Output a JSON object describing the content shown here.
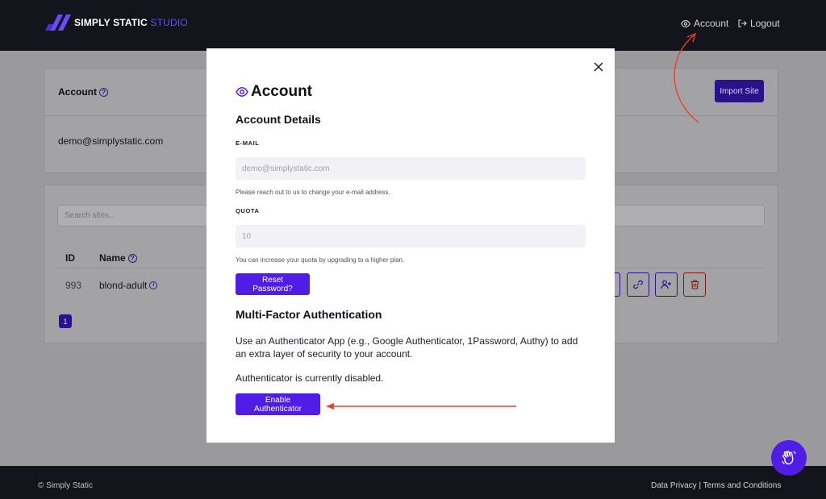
{
  "header": {
    "logo_main": "SIMPLY STATIC",
    "logo_accent": "STUDIO",
    "nav": {
      "account_label": "Account",
      "logout_label": "Logout"
    }
  },
  "background": {
    "account_card": {
      "title": "Account",
      "email": "demo@simplystatic.com",
      "import_label": "Import Site"
    },
    "sites_card": {
      "search_placeholder": "Search sites..",
      "columns": {
        "id": "ID",
        "name": "Name"
      },
      "rows": [
        {
          "id": "993",
          "name": "blond-adult"
        }
      ],
      "current_page": "1"
    }
  },
  "modal": {
    "title": "Account",
    "details_heading": "Account Details",
    "email_label": "E-MAIL",
    "email_placeholder": "demo@simplystatic.com",
    "email_hint": "Please reach out to us to change your e-mail address.",
    "quota_label": "QUOTA",
    "quota_placeholder": "10",
    "quota_hint": "You can increase your quota by upgrading to a higher plan.",
    "reset_label": "Reset Password?",
    "mfa_heading": "Multi-Factor Authentication",
    "mfa_description": "Use an Authenticator App (e.g., Google Authenticator, 1Password, Authy) to add an extra layer of security to your account.",
    "mfa_status": "Authenticator is currently disabled.",
    "enable_label": "Enable Authenticator"
  },
  "footer": {
    "copyright": "© Simply Static",
    "links": "Data Privacy | Terms and Conditions"
  },
  "colors": {
    "brand": "#4f1de6",
    "annotation": "#e8402a",
    "header_bg": "#14141c"
  },
  "icons": [
    "eye-icon",
    "logout-icon",
    "close-icon",
    "question-icon",
    "info-icon",
    "link-icon",
    "user-plus-icon",
    "trash-icon",
    "wave-hand-icon"
  ]
}
